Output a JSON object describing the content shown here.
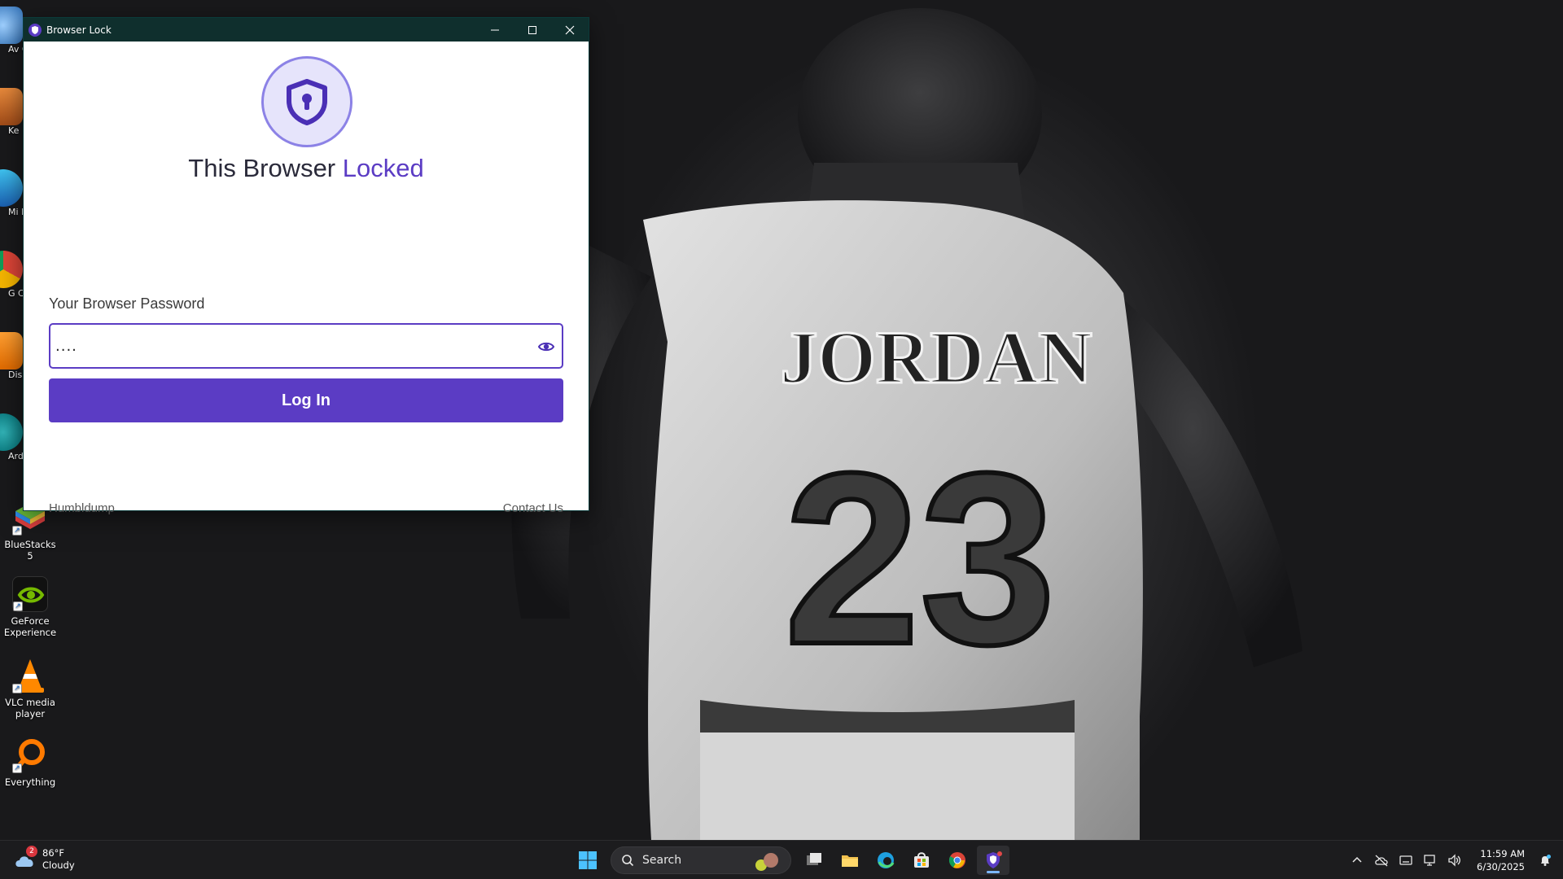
{
  "desktop": {
    "icons": [
      {
        "label": "BlueStacks 5"
      },
      {
        "label": "GeForce Experience"
      },
      {
        "label": "VLC media player"
      },
      {
        "label": "Everything"
      }
    ],
    "partial_icons": [
      {
        "label": "Av Ch"
      },
      {
        "label": "Ke"
      },
      {
        "label": "Mi E"
      },
      {
        "label": "G Ch"
      },
      {
        "label": "Dis"
      },
      {
        "label": "Ardu"
      }
    ]
  },
  "window": {
    "title": "Browser Lock",
    "heading_prefix": "This Browser ",
    "heading_accent": "Locked",
    "password_label": "Your Browser Password",
    "password_value": "....",
    "login_label": "Log In",
    "footer_left": "Humbldump",
    "footer_right": "Contact Us",
    "accent_color": "#5b3cc4"
  },
  "taskbar": {
    "weather_temp": "86°F",
    "weather_desc": "Cloudy",
    "weather_badge": "2",
    "search_label": "Search",
    "time": "11:59 AM",
    "date": "6/30/2025"
  },
  "wallpaper": {
    "jersey_name": "JORDAN",
    "jersey_number": "23"
  }
}
